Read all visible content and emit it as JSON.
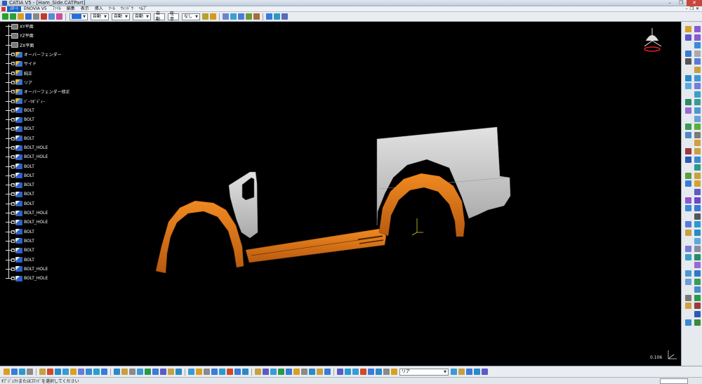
{
  "window": {
    "title": "CATIA V5 - [Ham_Side.CATPart]",
    "buttons": [
      "–",
      "❐",
      "✕"
    ]
  },
  "menubar": {
    "items": [
      "ｽﾀｰﾄ",
      "ENOVIA V5",
      "ﾌｧｲﾙ",
      "編集",
      "表示",
      "挿入",
      "ﾂｰﾙ",
      "ｳｨﾝﾄﾞｳ",
      "ﾍﾙﾌﾟ"
    ],
    "window_controls": [
      "–",
      "❐",
      "✕"
    ]
  },
  "toolbar": {
    "combo_autos": [
      "自動",
      "自動",
      "自動"
    ],
    "combo_line": "自動",
    "combo_none": "なし",
    "combo_3": "任意"
  },
  "tree": {
    "items": [
      {
        "label": "XY平面",
        "icon": "plane-icon"
      },
      {
        "label": "YZ平面",
        "icon": "plane-icon"
      },
      {
        "label": "ZX平面",
        "icon": "plane-icon"
      },
      {
        "label": "オーバーフェンダー",
        "icon": "body-icon"
      },
      {
        "label": "サイド",
        "icon": "body-icon"
      },
      {
        "label": "純正",
        "icon": "body-icon"
      },
      {
        "label": "リア",
        "icon": "body-icon"
      },
      {
        "label": "オーバーフェンダー修正",
        "icon": "body-icon"
      },
      {
        "label": "ﾊﾟｰﾂﾎﾞﾃﾞｨｰ",
        "icon": "body-icon"
      },
      {
        "label": "BOLT",
        "icon": "bolt-icon"
      },
      {
        "label": "BOLT",
        "icon": "bolt-icon"
      },
      {
        "label": "BOLT",
        "icon": "bolt-icon"
      },
      {
        "label": "BOLT",
        "icon": "bolt-icon"
      },
      {
        "label": "BOLT_HOLE",
        "icon": "bolt-icon"
      },
      {
        "label": "BOLT_HOLE",
        "icon": "bolt-icon"
      },
      {
        "label": "BOLT",
        "icon": "bolt-icon"
      },
      {
        "label": "BOLT",
        "icon": "bolt-icon"
      },
      {
        "label": "BOLT",
        "icon": "bolt-icon"
      },
      {
        "label": "BOLT",
        "icon": "bolt-icon"
      },
      {
        "label": "BOLT",
        "icon": "bolt-icon"
      },
      {
        "label": "BOLT_HOLE",
        "icon": "bolt-icon"
      },
      {
        "label": "BOLT_HOLE",
        "icon": "bolt-icon"
      },
      {
        "label": "BOLT",
        "icon": "bolt-icon"
      },
      {
        "label": "BOLT",
        "icon": "bolt-icon"
      },
      {
        "label": "BOLT",
        "icon": "bolt-icon"
      },
      {
        "label": "BOLT",
        "icon": "bolt-icon"
      },
      {
        "label": "BOLT_HOLE",
        "icon": "bolt-icon"
      },
      {
        "label": "BOLT_HOLE",
        "icon": "bolt-icon"
      }
    ]
  },
  "viewport": {
    "scale_label": "0.106",
    "part_colors": {
      "fender": "#e07818",
      "body": "#c9c9c9",
      "background": "#000000"
    }
  },
  "bottom": {
    "layer_combo": "リア"
  },
  "status": {
    "prompt": "ｵﾌﾞｼﾞｪｸﾄまたはｺﾏﾝﾄﾞを選択してください"
  }
}
